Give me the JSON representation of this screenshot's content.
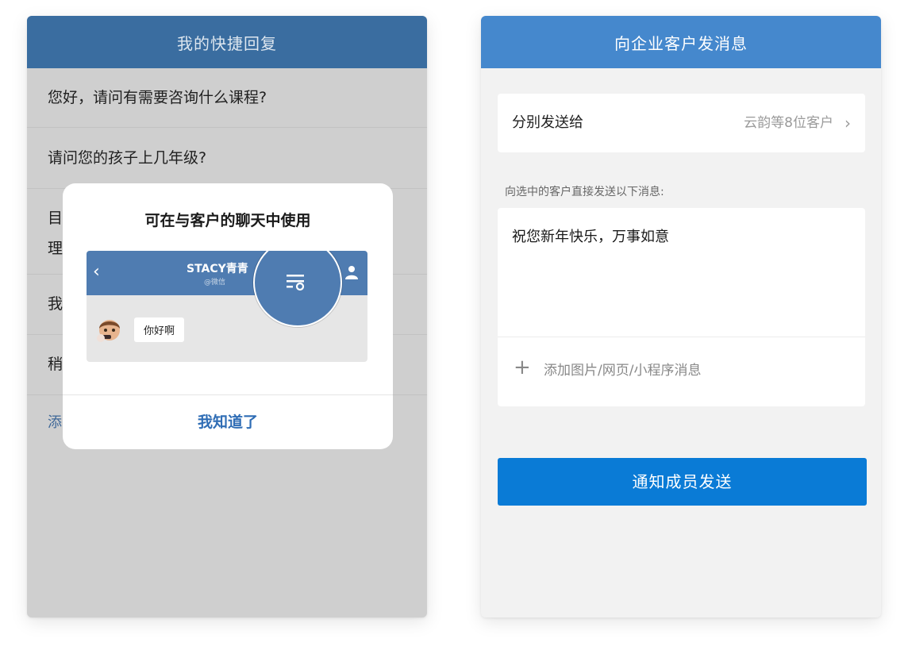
{
  "left_screen": {
    "title": "我的快捷回复",
    "replies": [
      "您好，请问有需要咨询什么课程?",
      "请问您的孩子上几年级?",
      "目",
      "理",
      "我",
      "稍"
    ],
    "add_link": "添",
    "modal": {
      "title": "可在与客户的聊天中使用",
      "preview_chat_name": "STACY青青",
      "preview_chat_sub": "@微信",
      "preview_bubble": "你好啊",
      "button": "我知道了"
    }
  },
  "right_screen": {
    "title": "向企业客户发消息",
    "recipient_label": "分别发送给",
    "recipient_value": "云韵等8位客户",
    "hint": "向选中的客户直接发送以下消息:",
    "message_text": "祝您新年快乐，万事如意",
    "attach_label": "添加图片/网页/小程序消息",
    "send_button": "通知成员发送"
  },
  "icons": {
    "back": "back-chevron-icon",
    "person": "person-icon",
    "quick_reply": "quick-reply-icon",
    "chevron": "chevron-right-icon",
    "plus": "plus-icon"
  },
  "colors": {
    "left_nav": "#3a6da0",
    "right_nav": "#4588cd",
    "primary_button": "#0a7bd6",
    "link": "#2f6db5"
  }
}
